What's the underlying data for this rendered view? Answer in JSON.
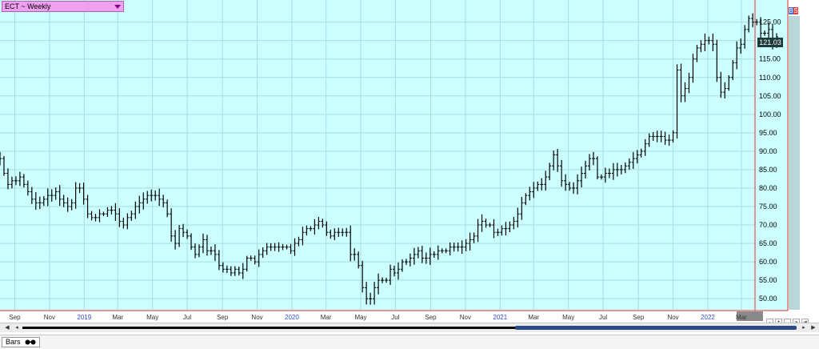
{
  "window": {
    "symbol_label": "ECT ~ Weekly",
    "buy_tag": "B",
    "sell_tag": "S",
    "tab_label": "Bars"
  },
  "colors": {
    "plot_background": "#ccffff",
    "gridline": "#a8dede",
    "bars": "#000000",
    "scale_line": "#e03030",
    "year_label": "#2a4adc",
    "month_label": "#333333"
  },
  "chart_data": {
    "type": "ohlc",
    "title": "",
    "xlabel": "",
    "ylabel": "",
    "ylim": [
      47,
      131
    ],
    "yticks": [
      50,
      55,
      60,
      65,
      70,
      75,
      80,
      85,
      90,
      95,
      100,
      105,
      110,
      115,
      120,
      125
    ],
    "ytick_labels": [
      "50.00",
      "55.00",
      "60.00",
      "65.00",
      "70.00",
      "75.00",
      "80.00",
      "85.00",
      "90.00",
      "95.00",
      "100.00",
      "105.00",
      "110.00",
      "115.00",
      "120.00",
      "125.00"
    ],
    "xlim": [
      "2018-08-06",
      "2022-03-25"
    ],
    "xticks": [
      {
        "label": "Sep",
        "date": "2018-09-01",
        "year": false
      },
      {
        "label": "Nov",
        "date": "2018-11-01",
        "year": false
      },
      {
        "label": "2019",
        "date": "2019-01-01",
        "year": true
      },
      {
        "label": "Mar",
        "date": "2019-03-01",
        "year": false
      },
      {
        "label": "May",
        "date": "2019-05-01",
        "year": false
      },
      {
        "label": "Jul",
        "date": "2019-07-01",
        "year": false
      },
      {
        "label": "Sep",
        "date": "2019-09-01",
        "year": false
      },
      {
        "label": "Nov",
        "date": "2019-11-01",
        "year": false
      },
      {
        "label": "2020",
        "date": "2020-01-01",
        "year": true
      },
      {
        "label": "Mar",
        "date": "2020-03-01",
        "year": false
      },
      {
        "label": "May",
        "date": "2020-05-01",
        "year": false
      },
      {
        "label": "Jul",
        "date": "2020-07-01",
        "year": false
      },
      {
        "label": "Sep",
        "date": "2020-09-01",
        "year": false
      },
      {
        "label": "Nov",
        "date": "2020-11-01",
        "year": false
      },
      {
        "label": "2021",
        "date": "2021-01-01",
        "year": true
      },
      {
        "label": "Mar",
        "date": "2021-03-01",
        "year": false
      },
      {
        "label": "May",
        "date": "2021-05-01",
        "year": false
      },
      {
        "label": "Jul",
        "date": "2021-07-01",
        "year": false
      },
      {
        "label": "Sep",
        "date": "2021-09-01",
        "year": false
      },
      {
        "label": "Nov",
        "date": "2021-11-01",
        "year": false
      },
      {
        "label": "2022",
        "date": "2022-01-01",
        "year": true
      },
      {
        "label": "Mar",
        "date": "2022-03-01",
        "year": false
      }
    ],
    "grid": true,
    "last_price_label": "121.03",
    "series": [
      {
        "closes_weekly_start": "2018-08-06",
        "close": [
          88,
          84,
          81,
          82,
          82,
          83,
          81,
          79,
          77,
          76,
          76,
          77,
          78,
          78,
          79,
          77,
          76,
          75,
          76,
          80,
          80,
          77,
          73,
          72,
          72,
          73,
          73,
          74,
          74,
          73,
          71,
          70,
          72,
          73,
          75,
          76,
          77,
          78,
          78,
          78,
          77,
          76,
          73,
          67,
          65,
          69,
          68,
          67,
          64,
          62,
          64,
          66,
          63,
          63,
          62,
          59,
          58,
          58,
          57,
          58,
          57,
          58,
          61,
          61,
          60,
          62,
          63,
          64,
          64,
          64,
          64,
          64,
          64,
          63,
          65,
          66,
          68,
          69,
          69,
          70,
          71,
          70,
          68,
          67,
          68,
          68,
          68,
          68,
          62,
          62,
          59,
          53,
          50,
          50,
          53,
          55,
          55,
          55,
          58,
          57,
          58,
          60,
          60,
          61,
          62,
          63,
          61,
          61,
          62,
          62,
          63,
          63,
          63,
          64,
          64,
          64,
          64,
          65,
          66,
          67,
          70,
          71,
          70,
          70,
          68,
          68,
          69,
          69,
          70,
          71,
          73,
          76,
          78,
          79,
          80,
          81,
          81,
          83,
          86,
          89,
          86,
          82,
          81,
          80,
          80,
          82,
          84,
          86,
          88,
          88,
          83,
          83,
          84,
          84,
          85,
          85,
          85,
          86,
          87,
          88,
          89,
          90,
          92,
          94,
          94,
          94,
          94,
          93,
          93,
          95,
          112,
          105,
          107,
          110,
          115,
          118,
          119,
          120,
          120,
          119,
          110,
          106,
          107,
          110,
          114,
          118,
          119,
          123,
          126,
          125,
          125,
          122,
          122,
          123,
          119,
          121
        ]
      }
    ]
  }
}
